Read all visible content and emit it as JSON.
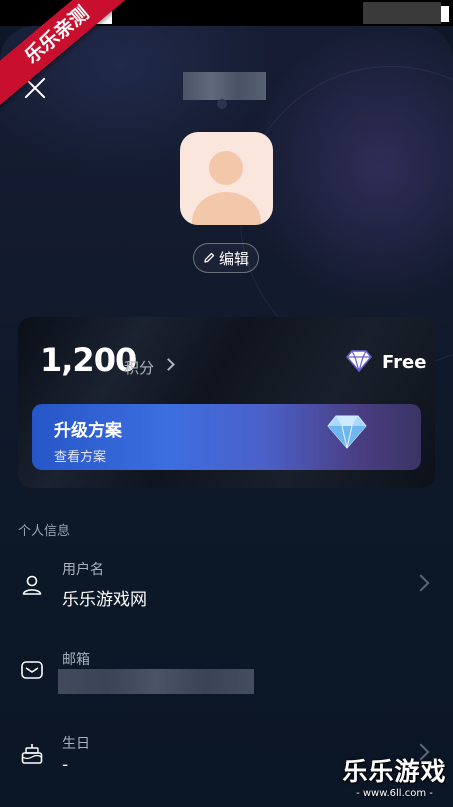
{
  "watermark": {
    "corner_text": "乐乐亲测",
    "main": "乐乐游戏",
    "sub": "- www.6ll.com -"
  },
  "header": {
    "close_icon": "close-icon"
  },
  "profile": {
    "edit_label": "编辑",
    "edit_icon": "pencil-icon"
  },
  "points_card": {
    "points": "1,200",
    "points_label": "积分",
    "plan_icon": "diamond-icon",
    "plan": "Free",
    "upgrade_title": "升级方案",
    "upgrade_subtitle": "查看方案",
    "upgrade_icon": "gem-icon"
  },
  "personal_info": {
    "section_title": "个人信息",
    "username": {
      "icon": "user-icon",
      "label": "用户名",
      "value": "乐乐游戏网"
    },
    "email": {
      "icon": "mail-icon",
      "label": "邮箱"
    },
    "birthday": {
      "icon": "cake-icon",
      "label": "生日",
      "value": "-"
    }
  },
  "colors": {
    "background": "#0d1727",
    "banner_start": "#2656c7",
    "banner_end": "#3a3466",
    "avatar_bg": "#fae6dc",
    "badge_red": "#c8102e"
  }
}
